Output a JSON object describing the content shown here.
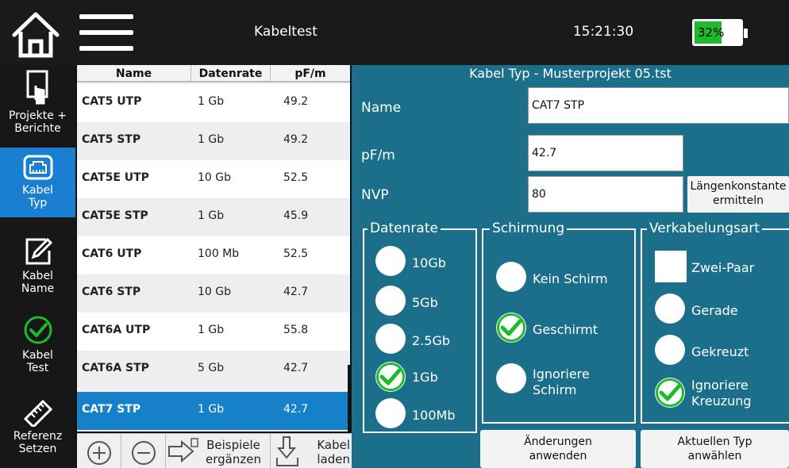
{
  "topbar": {
    "title": "Kabeltest",
    "time": "15:21:30",
    "battery_percent": "32%",
    "battery_level": 0.32,
    "home_icon": "home-icon",
    "menu_icon": "hamburger-menu-icon"
  },
  "sidebar": {
    "items": [
      {
        "label_line1": "Projekte +",
        "label_line2": "Berichte",
        "icon": "document-touch-icon",
        "active": false
      },
      {
        "label_line1": "Kabel",
        "label_line2": "Typ",
        "icon": "ethernet-port-icon",
        "active": true
      },
      {
        "label_line1": "Kabel",
        "label_line2": "Name",
        "icon": "edit-pencil-icon",
        "active": false
      },
      {
        "label_line1": "Kabel",
        "label_line2": "Test",
        "icon": "check-circle-icon",
        "active": false
      },
      {
        "label_line1": "Referenz",
        "label_line2": "Setzen",
        "icon": "ruler-icon",
        "active": false
      }
    ]
  },
  "table": {
    "headers": [
      "Name",
      "Datenrate",
      "pF/m"
    ],
    "rows": [
      {
        "name": "CAT5 UTP",
        "rate": "1 Gb",
        "pf": "49.2"
      },
      {
        "name": "CAT5 STP",
        "rate": "1 Gb",
        "pf": "49.2"
      },
      {
        "name": "CAT5E UTP",
        "rate": "10 Gb",
        "pf": "52.5"
      },
      {
        "name": "CAT5E STP",
        "rate": "1 Gb",
        "pf": "45.9"
      },
      {
        "name": "CAT6 UTP",
        "rate": "100 Mb",
        "pf": "52.5"
      },
      {
        "name": "CAT6 STP",
        "rate": "10 Gb",
        "pf": "42.7"
      },
      {
        "name": "CAT6A UTP",
        "rate": "1 Gb",
        "pf": "55.8"
      },
      {
        "name": "CAT6A STP",
        "rate": "5 Gb",
        "pf": "42.7"
      },
      {
        "name": "CAT7 STP",
        "rate": "1 Gb",
        "pf": "42.7"
      }
    ],
    "selected_index": 8,
    "toolbar": {
      "add_icon": "plus-circle-icon",
      "remove_icon": "minus-circle-icon",
      "examples_line1": "Beispiele",
      "examples_line2": "ergänzen",
      "load_line1": "Kabel",
      "load_line2": "laden"
    }
  },
  "panel": {
    "title": "Kabel Typ - Musterprojekt 05.tst",
    "name_label": "Name",
    "name_value": "CAT7 STP",
    "pf_label": "pF/m",
    "pf_value": "42.7",
    "nvp_label": "NVP",
    "nvp_value": "80",
    "laengen_line1": "Längenkonstante",
    "laengen_line2": "ermitteln",
    "datenrate": {
      "title": "Datenrate",
      "options": [
        "10Gb",
        "5Gb",
        "2.5Gb",
        "1Gb",
        "100Mb"
      ],
      "selected": "1Gb"
    },
    "schirmung": {
      "title": "Schirmung",
      "options": [
        "Kein Schirm",
        "Geschirmt",
        "Ignoriere Schirm"
      ],
      "ignore_line1": "Ignoriere",
      "ignore_line2": "Schirm",
      "selected": "Geschirmt"
    },
    "verkabelung": {
      "title": "Verkabelungsart",
      "options": [
        "Zwei-Paar",
        "Gerade",
        "Gekreuzt",
        "Ignoriere Kreuzung"
      ],
      "ignore_line1": "Ignoriere",
      "ignore_line2": "Kreuzung",
      "selected": "Ignoriere Kreuzung"
    },
    "apply_line1": "Änderungen",
    "apply_line2": "anwenden",
    "select_line1": "Aktuellen Typ",
    "select_line2": "anwählen"
  },
  "colors": {
    "accent": "#1681c8",
    "panel": "#1c6f8a",
    "check": "#1dbb2c"
  }
}
